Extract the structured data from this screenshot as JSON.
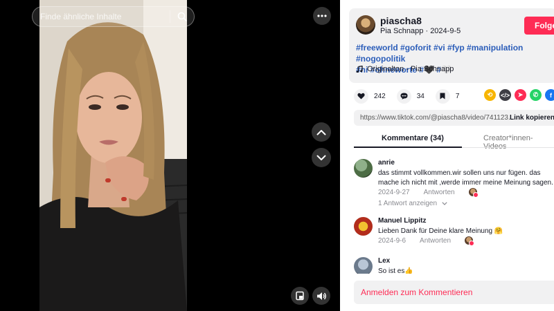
{
  "search": {
    "placeholder": "Finde ähnliche Inhalte"
  },
  "author": {
    "username": "piascha8",
    "display_name": "Pia Schnapp",
    "date": "2024-9-5",
    "follow_label": "Folge"
  },
  "description": {
    "line1": "#freeworld #goforit #vi #fyp #manipulation #nogopolitik",
    "line2": "#ni #ohneworte #🖤 #🤍"
  },
  "music": {
    "label": "Originalton - Pia Schnapp"
  },
  "actions": {
    "likes": "242",
    "comments": "34",
    "saves": "7"
  },
  "share": {
    "url": "https://www.tiktok.com/@piascha8/video/741123...",
    "copy_label": "Link kopieren"
  },
  "tabs": {
    "comments_label": "Kommentare (34)",
    "creator_label": "Creator*innen-Videos"
  },
  "comments": [
    {
      "name": "anrie",
      "text": "das stimmt vollkommen.wir sollen uns nur fügen. das mache ich nicht mit ,werde immer meine Meinung sagen.",
      "date": "2024-9-27",
      "reply_label": "Antworten",
      "view_replies": "1 Antwort anzeigen"
    },
    {
      "name": "Manuel Lippitz",
      "text": "Lieben Dank für Deine klare Meinung 🤗",
      "date": "2024-9-6",
      "reply_label": "Antworten"
    },
    {
      "name": "Lex",
      "text": "So ist es👍"
    }
  ],
  "login": {
    "label": "Anmelden zum Kommentieren"
  },
  "colors": {
    "accent": "#fe2c55",
    "hashtag": "#2b5db9"
  }
}
